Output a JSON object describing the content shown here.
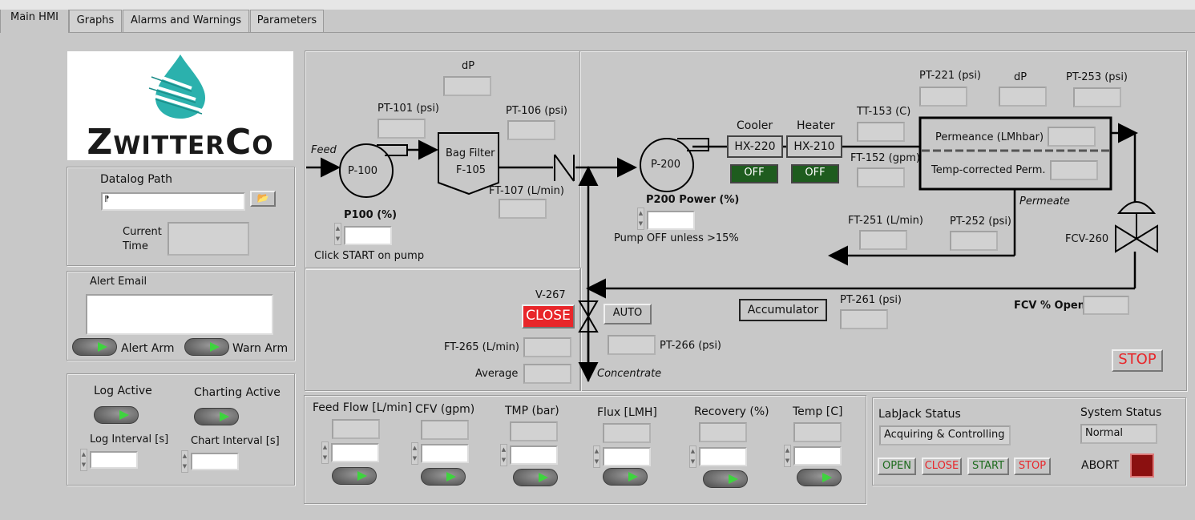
{
  "tabs": [
    {
      "label": "Main HMI"
    },
    {
      "label": "Graphs"
    },
    {
      "label": "Alarms and Warnings"
    },
    {
      "label": "Parameters"
    }
  ],
  "logo": {
    "brand": "ZwitterCo",
    "brand_color": "#2bb1ad"
  },
  "datalog": {
    "title": "Datalog Path",
    "path_value": "",
    "path_icon": "path-icon",
    "browse_icon": "folder-icon",
    "current_time_label": "Current Time",
    "current_time_value": ""
  },
  "alert": {
    "title": "Alert Email",
    "email_value": "",
    "alert_arm_label": "Alert Arm",
    "warn_arm_label": "Warn Arm"
  },
  "logging": {
    "log_active_label": "Log Active",
    "charting_active_label": "Charting Active",
    "log_interval_label": "Log Interval [s]",
    "chart_interval_label": "Chart Interval [s]",
    "log_interval_value": "",
    "chart_interval_value": ""
  },
  "feed_section": {
    "feed_label": "Feed",
    "dp_label": "dP",
    "pt101_label": "PT-101 (psi)",
    "pt106_label": "PT-106 (psi)",
    "ft107_label": "FT-107 (L/min)",
    "p100_name": "P-100",
    "filter_name_1": "Bag Filter",
    "filter_name_2": "F-105",
    "p100_power_label": "P100 (%)",
    "p100_hint": "Click START on pump",
    "p100_power_value": ""
  },
  "loop_section": {
    "p200_name": "P-200",
    "p200_power_label": "P200 Power (%)",
    "p200_hint": "Pump OFF unless >15%",
    "p200_power_value": "",
    "cooler_label": "Cooler",
    "heater_label": "Heater",
    "hx220_name": "HX-220",
    "hx210_name": "HX-210",
    "cooler_state": "OFF",
    "heater_state": "OFF",
    "tt153_label": "TT-153 (C)",
    "ft152_label": "FT-152 (gpm)",
    "pt221_label": "PT-221 (psi)",
    "dp_label": "dP",
    "pt253_label": "PT-253 (psi)",
    "permeance_label": "Permeance (LMhbar)",
    "temp_corrected_label": "Temp-corrected Perm.",
    "permeate_label": "Permeate",
    "ft251_label": "FT-251 (L/min)",
    "pt252_label": "PT-252 (psi)",
    "fcv260_name": "FCV-260",
    "fcv_open_label": "FCV % Open",
    "fcv_open_value": "",
    "v267_name": "V-267",
    "v267_close_label": "CLOSE",
    "v267_auto_label": "AUTO",
    "ft265_label": "FT-265 (L/min)",
    "average_label": "Average",
    "pt266_label": "PT-266 (psi)",
    "concentrate_label": "Concentrate",
    "accumulator_label": "Accumulator",
    "pt261_label": "PT-261 (psi)",
    "stop_label": "STOP"
  },
  "setpoints": [
    {
      "label": "Feed Flow [L/min]",
      "value": ""
    },
    {
      "label": "CFV (gpm)",
      "value": ""
    },
    {
      "label": "TMP (bar)",
      "value": ""
    },
    {
      "label": "Flux [LMH]",
      "value": ""
    },
    {
      "label": "Recovery (%)",
      "value": ""
    },
    {
      "label": "Temp [C]",
      "value": ""
    }
  ],
  "labjack": {
    "status_title": "LabJack Status",
    "status_value": "Acquiring & Controlling",
    "system_status_title": "System Status",
    "system_status_value": "Normal",
    "open_label": "OPEN",
    "close_label": "CLOSE",
    "start_label": "START",
    "stop_label": "STOP",
    "abort_label": "ABORT"
  },
  "colors": {
    "active_led": "#3fd33f",
    "close_red": "#e8262a",
    "off_green": "#1e5c1e",
    "abort_red": "#8b1010"
  }
}
